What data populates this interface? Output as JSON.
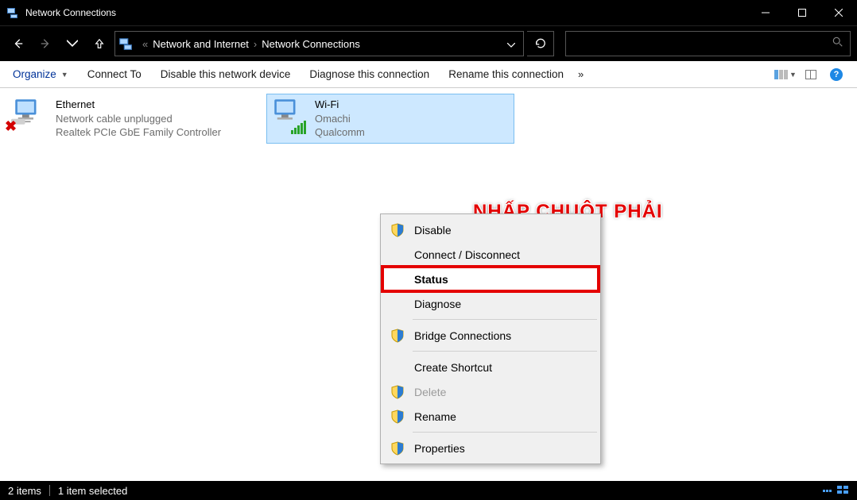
{
  "title_bar": {
    "title": "Network Connections"
  },
  "breadcrumb": {
    "part1": "Network and Internet",
    "part2": "Network Connections"
  },
  "toolbar": {
    "organize": "Organize",
    "connect_to": "Connect To",
    "disable": "Disable this network device",
    "diagnose": "Diagnose this connection",
    "rename": "Rename this connection"
  },
  "connections": {
    "ethernet": {
      "name": "Ethernet",
      "status": "Network cable unplugged",
      "adapter": "Realtek PCIe GbE Family Controller"
    },
    "wifi": {
      "name": "Wi-Fi",
      "status": "Omachi",
      "adapter": "Qualcomm"
    }
  },
  "context_menu": {
    "disable": "Disable",
    "connect": "Connect / Disconnect",
    "status": "Status",
    "diagnose": "Diagnose",
    "bridge": "Bridge Connections",
    "shortcut": "Create Shortcut",
    "delete": "Delete",
    "rename": "Rename",
    "properties": "Properties"
  },
  "annotation": "NHẤP CHUỘT PHẢI",
  "status_bar": {
    "items": "2 items",
    "selected": "1 item selected"
  }
}
